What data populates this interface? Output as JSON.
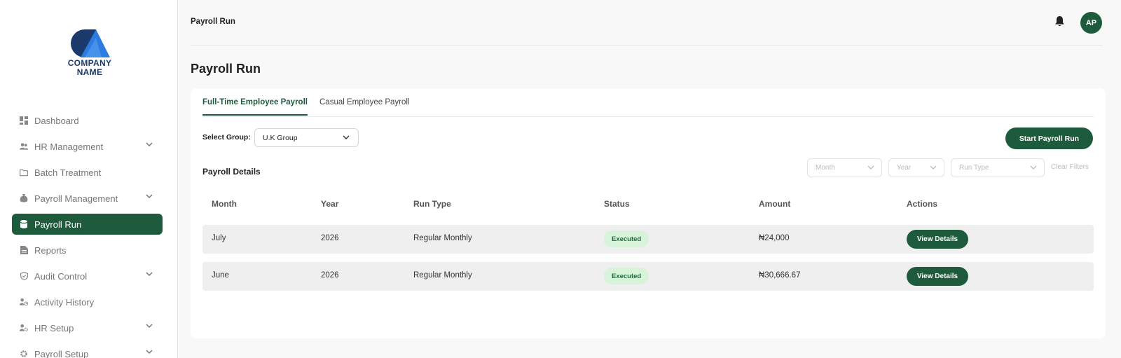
{
  "brand": {
    "logo_line1": "COMPANY",
    "logo_line2": "NAME",
    "primary_color": "#1e5b3d",
    "logo_color_dark": "#1b3a6b",
    "logo_color_light": "#2b7be0"
  },
  "sidebar": {
    "items": [
      {
        "label": "Dashboard",
        "icon": "dashboard-icon",
        "has_chevron": false
      },
      {
        "label": "HR Management",
        "icon": "people-icon",
        "has_chevron": true
      },
      {
        "label": "Batch Treatment",
        "icon": "folder-icon",
        "has_chevron": false
      },
      {
        "label": "Payroll Management",
        "icon": "money-bag-icon",
        "has_chevron": true
      },
      {
        "label": "Payroll Run",
        "icon": "database-icon",
        "has_chevron": false,
        "active": true
      },
      {
        "label": "Reports",
        "icon": "document-icon",
        "has_chevron": false
      },
      {
        "label": "Audit Control",
        "icon": "shield-icon",
        "has_chevron": true
      },
      {
        "label": "Activity History",
        "icon": "user-clock-icon",
        "has_chevron": false
      },
      {
        "label": "HR Setup",
        "icon": "user-gear-icon",
        "has_chevron": true
      },
      {
        "label": "Payroll Setup",
        "icon": "gear-icon",
        "has_chevron": true
      }
    ]
  },
  "topbar": {
    "title": "Payroll Run",
    "avatar_initials": "AP"
  },
  "page": {
    "title": "Payroll Run"
  },
  "tabs": [
    {
      "label": "Full-Time Employee Payroll",
      "active": true
    },
    {
      "label": "Casual Employee Payroll",
      "active": false
    }
  ],
  "group": {
    "label": "Select Group:",
    "value": "U.K Group"
  },
  "actions": {
    "start_label": "Start Payroll Run"
  },
  "details": {
    "title": "Payroll Details",
    "filters": {
      "month": "Month",
      "year": "Year",
      "run_type": "Run Type",
      "clear": "Clear Filters"
    }
  },
  "table": {
    "headers": {
      "month": "Month",
      "year": "Year",
      "run_type": "Run Type",
      "status": "Status",
      "amount": "Amount",
      "actions": "Actions"
    },
    "rows": [
      {
        "month": "July",
        "year": "2026",
        "run_type": "Regular Monthly",
        "status": "Executed",
        "amount": "₦24,000",
        "action": "View Details"
      },
      {
        "month": "June",
        "year": "2026",
        "run_type": "Regular Monthly",
        "status": "Executed",
        "amount": "₦30,666.67",
        "action": "View Details"
      }
    ]
  }
}
